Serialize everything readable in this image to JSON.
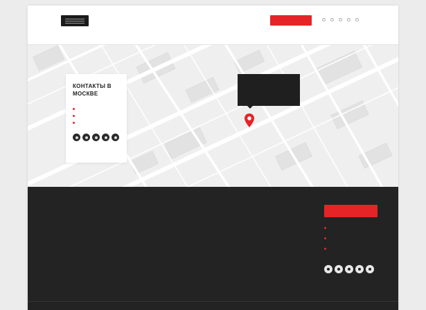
{
  "header": {
    "brand_text": "",
    "city_label": "",
    "city_value": "",
    "phone_label": "",
    "phone_value": "",
    "cta_label": ""
  },
  "nav": {
    "items": [
      "",
      "",
      "",
      "",
      "",
      "",
      "",
      ""
    ]
  },
  "contact_card": {
    "title": "КОНТАКТЫ В МОСКВЕ",
    "phone": "",
    "email": "",
    "address": ""
  },
  "map_popup": {
    "line1": "",
    "line2": "",
    "line3": ""
  },
  "footer": {
    "col1_title": "",
    "col1_items": [
      "",
      "",
      "",
      "",
      "",
      "",
      ""
    ],
    "col2_title": "",
    "col2_items": [
      "",
      "",
      "",
      "",
      ""
    ],
    "col3_title": "",
    "col3_items": [
      "",
      "",
      "",
      ""
    ],
    "cta_label": "",
    "phone": "",
    "email": "",
    "address": "",
    "copyright": "",
    "links": [
      "",
      ""
    ]
  },
  "colors": {
    "accent": "#e52427",
    "footer_bg": "#232323",
    "map_bg": "#efefef"
  },
  "icons": {
    "map_pin": "map-pin-icon",
    "social": [
      "vk-icon",
      "facebook-icon",
      "instagram-icon",
      "youtube-icon",
      "telegram-icon"
    ]
  }
}
